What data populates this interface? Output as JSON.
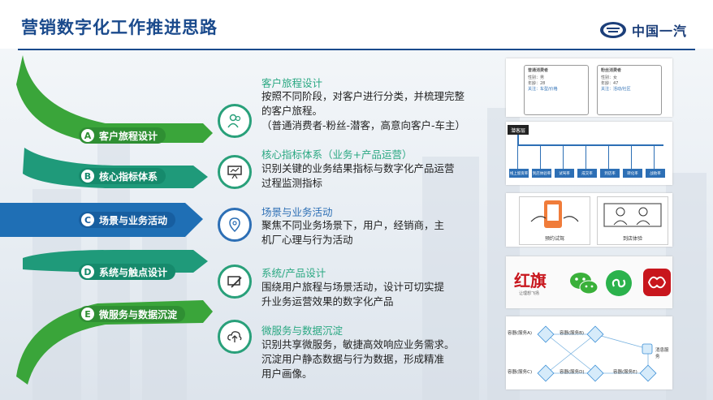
{
  "header": {
    "title": "营销数字化工作推进思路",
    "logo_text": "中国一汽"
  },
  "steps": [
    {
      "letter": "A",
      "label": "客户旅程设计"
    },
    {
      "letter": "B",
      "label": "核心指标体系"
    },
    {
      "letter": "C",
      "label": "场景与业务活动"
    },
    {
      "letter": "D",
      "label": "系统与触点设计"
    },
    {
      "letter": "E",
      "label": "微服务与数据沉淀"
    }
  ],
  "details": [
    {
      "heading": "客户旅程设计",
      "lines": [
        "按照不同阶段，对客户进行分类，并梳理完整",
        "的客户旅程。",
        "（普通消费者-粉丝-潜客，高意向客户-车主）"
      ]
    },
    {
      "heading": "核心指标体系（业务+产品运营）",
      "lines": [
        "识别关键的业务结果指标与数字化产品运营",
        "过程监测指标"
      ]
    },
    {
      "heading": "场景与业务活动",
      "lines": [
        "聚焦不同业务场景下，用户，经销商，主",
        "机厂心理与行为活动"
      ]
    },
    {
      "heading": "系统/产品设计",
      "lines": [
        "围绕用户旅程与场景活动，设计可切实提",
        "升业务运营效果的数字化产品"
      ]
    },
    {
      "heading": "微服务与数据沉淀",
      "lines": [
        "识别共享微服务，敏捷高效响应业务需求。",
        "沉淀用户静态数据与行为数据，形成精准",
        "用户画像。"
      ]
    }
  ],
  "panel1": {
    "card1_title": "普通消费者",
    "card1_lines": [
      "性别：男",
      "年龄：28",
      "关注：车型/价格"
    ],
    "card2_title": "粉丝消费者",
    "card2_lines": [
      "性别：女",
      "年龄：47",
      "关注：活动/社区"
    ]
  },
  "panel2": {
    "root": "潜客层",
    "nodes": [
      "线上留资率",
      "到店体验率",
      "试驾率",
      "成交率",
      "到店率",
      "转化率",
      "战败率"
    ]
  },
  "panel3": {
    "items": [
      "预约试驾",
      "到店体验"
    ]
  },
  "panel4": {
    "hongqi": "红旗",
    "hongqi_sub": "让理想飞扬"
  },
  "panel5": {
    "nodes": [
      "容器(服务A)",
      "容器(服务B)",
      "容器(服务C)",
      "容器(服务D)",
      "容器(服务E)",
      "消息服务"
    ]
  },
  "colors": {
    "green": "#29a07a",
    "blue": "#2d6fb5",
    "title": "#1a4a8c"
  }
}
